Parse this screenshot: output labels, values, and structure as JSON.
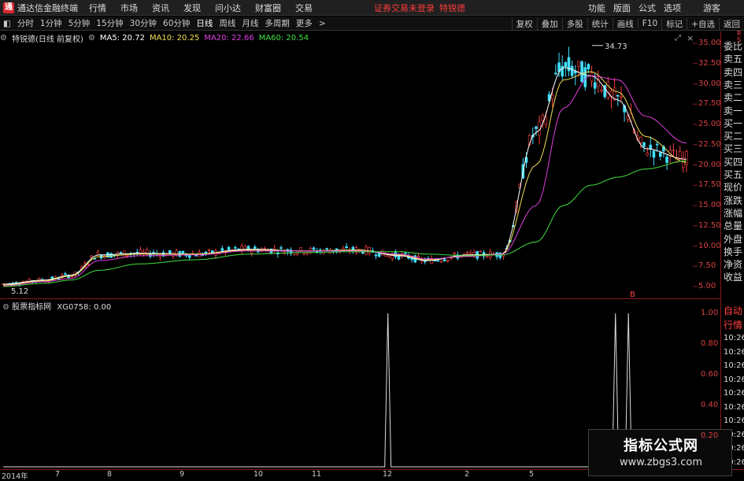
{
  "menubar": {
    "logo": "通",
    "app_title": "通达信金融终端",
    "items": [
      "行情",
      "市场",
      "资讯",
      "发现",
      "问小达",
      "财富圈",
      "交易"
    ],
    "warning": "证券交易未登录",
    "stock_name": "特锐德",
    "right_items": [
      "功能",
      "版面",
      "公式",
      "选项"
    ],
    "guest": "游客"
  },
  "toolbar": {
    "periods": [
      "分时",
      "1分钟",
      "5分钟",
      "15分钟",
      "30分钟",
      "60分钟",
      "日线",
      "周线",
      "月线",
      "多周期",
      "更多"
    ],
    "active_period": "日线",
    "right_buttons": [
      "复权",
      "叠加",
      "多股",
      "统计",
      "画线",
      "F10",
      "标记",
      "+自选",
      "返回"
    ]
  },
  "main_info": {
    "title": "特锐德(日线 前复权)",
    "ma5": "MA5: 20.72",
    "ma10": "MA10: 20.25",
    "ma20": "MA20: 22.66",
    "ma60": "MA60: 20.54",
    "colors": {
      "ma5": "#ffffff",
      "ma10": "#f0e050",
      "ma20": "#e040e0",
      "ma60": "#40e040"
    }
  },
  "price_axis": [
    "35.00",
    "32.50",
    "30.00",
    "27.50",
    "25.00",
    "22.50",
    "20.00",
    "17.50",
    "15.00",
    "12.50",
    "10.00",
    "7.50",
    "5.00"
  ],
  "price_labels": {
    "high": "34.73",
    "low": "5.12",
    "marker": "B"
  },
  "right_panel": {
    "top_glyphs": [
      "R",
      "S"
    ],
    "items": [
      "委比",
      "卖五",
      "卖四",
      "卖三",
      "卖二",
      "卖一",
      "买一",
      "买二",
      "买三",
      "买四",
      "买五",
      "现价",
      "涨跌",
      "涨幅",
      "总量",
      "外盘",
      "换手",
      "净资",
      "收益"
    ],
    "sub_items": [
      "自动",
      "行情",
      "10:26",
      "10:26",
      "10:26",
      "10:26",
      "10:26",
      "10:26",
      "10:26",
      "10:26",
      "10:26",
      "10:26"
    ]
  },
  "sub_info": {
    "title": "股票指标网",
    "value": "XG0758: 0.00"
  },
  "sub_axis": [
    "1.00",
    "0.80",
    "0.60",
    "0.40",
    "0.20"
  ],
  "time_axis": [
    "2014年",
    "7",
    "8",
    "9",
    "10",
    "11",
    "12",
    "2",
    "5"
  ],
  "chart_data": {
    "type": "line",
    "title": "特锐德(日线 前复权)",
    "y_range": [
      5,
      35
    ],
    "series": [
      {
        "name": "MA5",
        "values": [
          5.3,
          5.8,
          6.4,
          8.9,
          9.1,
          9.0,
          9.6,
          9.4,
          9.5,
          8.8,
          8.2,
          8.9,
          9.0,
          24.0,
          32.0,
          31.0,
          28.0,
          22.0,
          20.7
        ]
      },
      {
        "name": "MA10",
        "values": [
          5.2,
          5.7,
          6.3,
          8.7,
          9.0,
          9.0,
          9.5,
          9.4,
          9.5,
          8.9,
          8.3,
          8.8,
          9.0,
          20.0,
          30.5,
          31.5,
          29.0,
          23.5,
          20.3
        ]
      },
      {
        "name": "MA20",
        "values": [
          5.1,
          5.6,
          6.0,
          8.2,
          8.8,
          8.9,
          9.4,
          9.4,
          9.4,
          9.0,
          8.4,
          8.7,
          9.0,
          15.0,
          27.0,
          31.0,
          30.5,
          26.0,
          22.7
        ]
      },
      {
        "name": "MA60",
        "values": [
          5.0,
          5.4,
          5.8,
          7.0,
          7.8,
          8.3,
          9.0,
          9.2,
          9.3,
          9.3,
          9.0,
          8.8,
          8.9,
          10.5,
          15.0,
          17.5,
          18.5,
          19.5,
          20.5
        ]
      }
    ],
    "signals": {
      "name": "XG0758",
      "y_range": [
        0,
        1
      ],
      "spikes_at_fraction": [
        0.563,
        0.896,
        0.915
      ],
      "value": 1.0
    }
  },
  "watermark": {
    "line1": "指标公式网",
    "line2": "www.zbgs3.com"
  }
}
